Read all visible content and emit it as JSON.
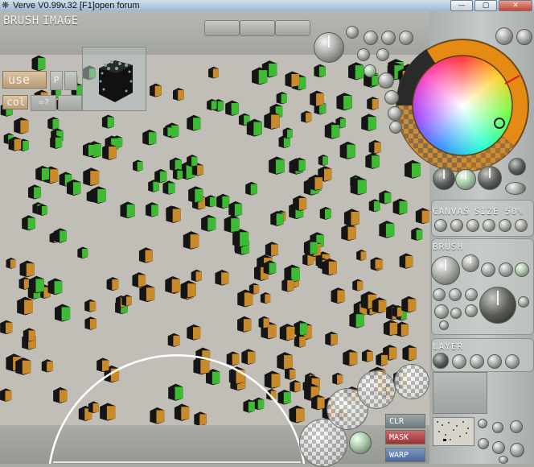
{
  "window": {
    "title": "Verve V0.99v.32 [F1]open forum",
    "minimize_label": "—",
    "maximize_label": "▢",
    "close_label": "✕"
  },
  "menu": {
    "brush_label": "BRUSH",
    "image_label": "IMAGE"
  },
  "brush_controls": {
    "use_label": "use",
    "p_label": "P",
    "col_label": "col",
    "col_value": "=?"
  },
  "panel": {
    "canvas_label": "CANVAS",
    "size_label": "SIZE 50%",
    "brush_label": "BRUSH",
    "layer_label": "LAYER"
  },
  "bottom_buttons": {
    "clr_label": "CLR",
    "mask_label": "MASK",
    "warp_label": "WARP"
  },
  "colors": {
    "canvas_bg": "#c1beb7",
    "cube_orange": "#c98a2a",
    "cube_green": "#3dbb33",
    "cube_dark": "#151515",
    "accent_orange": "#e58a12"
  }
}
